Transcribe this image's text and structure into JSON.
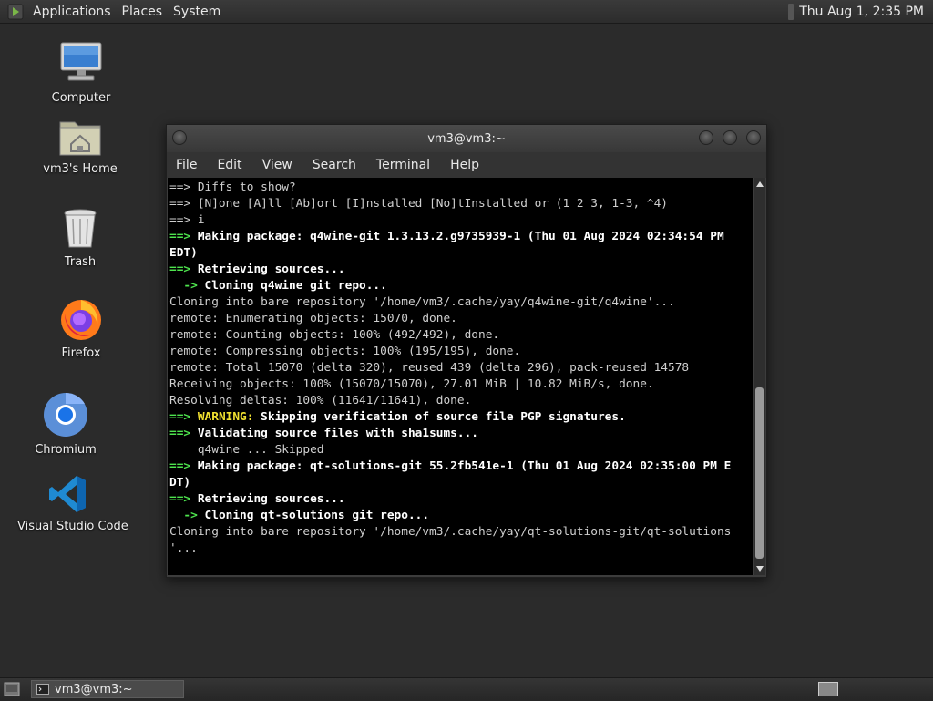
{
  "top_panel": {
    "menus": [
      "Applications",
      "Places",
      "System"
    ],
    "clock": "Thu Aug  1,  2:35 PM"
  },
  "desktop_icons": [
    {
      "label": "Computer",
      "icon": "computer-icon"
    },
    {
      "label": "vm3's Home",
      "icon": "home-folder-icon"
    },
    {
      "label": "Trash",
      "icon": "trash-icon"
    },
    {
      "label": "Firefox",
      "icon": "firefox-icon"
    },
    {
      "label": "Chromium",
      "icon": "chromium-icon"
    },
    {
      "label": "Visual Studio Code",
      "icon": "vscode-icon"
    }
  ],
  "window": {
    "title": "vm3@vm3:~",
    "menu": [
      "File",
      "Edit",
      "View",
      "Search",
      "Terminal",
      "Help"
    ]
  },
  "terminal_lines": [
    [
      {
        "t": "==> Diffs to show?",
        "c": ""
      }
    ],
    [
      {
        "t": "==> [N]one [A]ll [Ab]ort [I]nstalled [No]tInstalled or (1 2 3, 1-3, ^4)",
        "c": ""
      }
    ],
    [
      {
        "t": "==> i",
        "c": ""
      }
    ],
    [
      {
        "t": "==> ",
        "c": "g"
      },
      {
        "t": "Making package: q4wine-git 1.3.13.2.g9735939-1 (Thu 01 Aug 2024 02:34:54 PM",
        "c": "b"
      }
    ],
    [
      {
        "t": "EDT)",
        "c": "b"
      }
    ],
    [
      {
        "t": "==> ",
        "c": "g"
      },
      {
        "t": "Retrieving sources...",
        "c": "b"
      }
    ],
    [
      {
        "t": "  -> ",
        "c": "g"
      },
      {
        "t": "Cloning q4wine git repo...",
        "c": "b"
      }
    ],
    [
      {
        "t": "Cloning into bare repository '/home/vm3/.cache/yay/q4wine-git/q4wine'...",
        "c": ""
      }
    ],
    [
      {
        "t": "remote: Enumerating objects: 15070, done.",
        "c": ""
      }
    ],
    [
      {
        "t": "remote: Counting objects: 100% (492/492), done.",
        "c": ""
      }
    ],
    [
      {
        "t": "remote: Compressing objects: 100% (195/195), done.",
        "c": ""
      }
    ],
    [
      {
        "t": "remote: Total 15070 (delta 320), reused 439 (delta 296), pack-reused 14578",
        "c": ""
      }
    ],
    [
      {
        "t": "Receiving objects: 100% (15070/15070), 27.01 MiB | 10.82 MiB/s, done.",
        "c": ""
      }
    ],
    [
      {
        "t": "Resolving deltas: 100% (11641/11641), done.",
        "c": ""
      }
    ],
    [
      {
        "t": "==> ",
        "c": "g"
      },
      {
        "t": "WARNING: ",
        "c": "y"
      },
      {
        "t": "Skipping verification of source file PGP signatures.",
        "c": "b"
      }
    ],
    [
      {
        "t": "==> ",
        "c": "g"
      },
      {
        "t": "Validating source files with sha1sums...",
        "c": "b"
      }
    ],
    [
      {
        "t": "    q4wine ... Skipped",
        "c": ""
      }
    ],
    [
      {
        "t": "==> ",
        "c": "g"
      },
      {
        "t": "Making package: qt-solutions-git 55.2fb541e-1 (Thu 01 Aug 2024 02:35:00 PM E",
        "c": "b"
      }
    ],
    [
      {
        "t": "DT)",
        "c": "b"
      }
    ],
    [
      {
        "t": "==> ",
        "c": "g"
      },
      {
        "t": "Retrieving sources...",
        "c": "b"
      }
    ],
    [
      {
        "t": "  -> ",
        "c": "g"
      },
      {
        "t": "Cloning qt-solutions git repo...",
        "c": "b"
      }
    ],
    [
      {
        "t": "Cloning into bare repository '/home/vm3/.cache/yay/qt-solutions-git/qt-solutions",
        "c": ""
      }
    ],
    [
      {
        "t": "'...",
        "c": ""
      }
    ]
  ],
  "taskbar": {
    "task_label": "vm3@vm3:~"
  },
  "colors": {
    "prompt_green": "#4ee44e",
    "warning_yellow": "#f0e030",
    "terminal_bg": "#000000"
  }
}
